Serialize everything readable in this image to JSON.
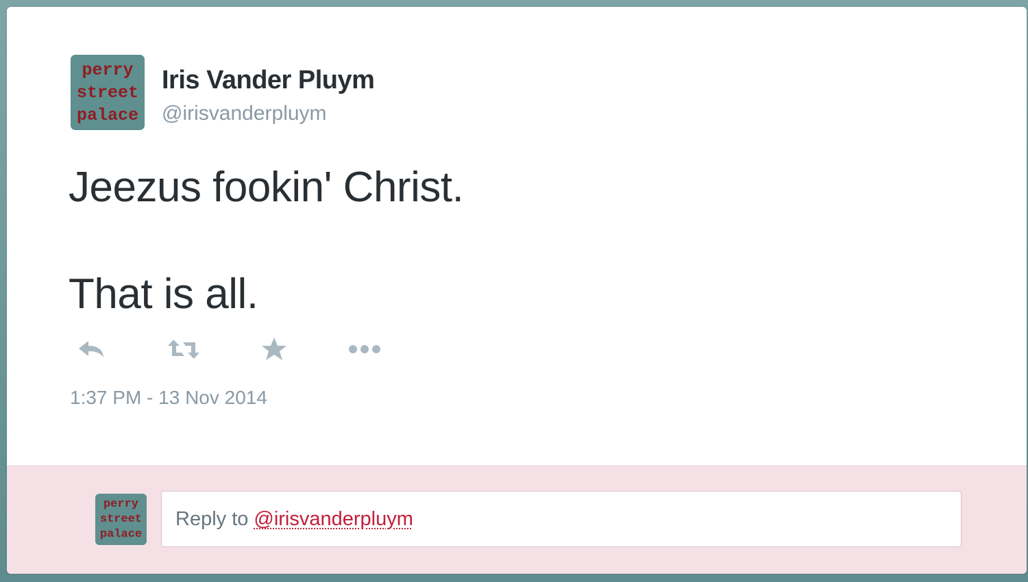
{
  "tweet": {
    "author_name": "Iris Vander Pluym",
    "author_handle": "@irisvanderpluym",
    "avatar_text": [
      "perry",
      "street",
      "palace"
    ],
    "text_lines": [
      "Jeezus fookin' Christ.",
      "That is all."
    ],
    "timestamp": "1:37 PM - 13 Nov 2014"
  },
  "actions": [
    {
      "name": "reply",
      "icon": "reply-icon"
    },
    {
      "name": "retweet",
      "icon": "retweet-icon"
    },
    {
      "name": "favorite",
      "icon": "star-icon"
    },
    {
      "name": "more",
      "icon": "more-icon"
    }
  ],
  "reply_box": {
    "prefix": "Reply to",
    "mention": "@irisvanderpluym"
  },
  "colors": {
    "text_primary": "#292f33",
    "text_secondary": "#8899a6",
    "icon": "#aab8c2",
    "reply_bar_bg": "#f5e0e6",
    "mention": "#c0203a",
    "avatar_bg": "#5f8f8f",
    "avatar_text": "#8f1d22"
  }
}
